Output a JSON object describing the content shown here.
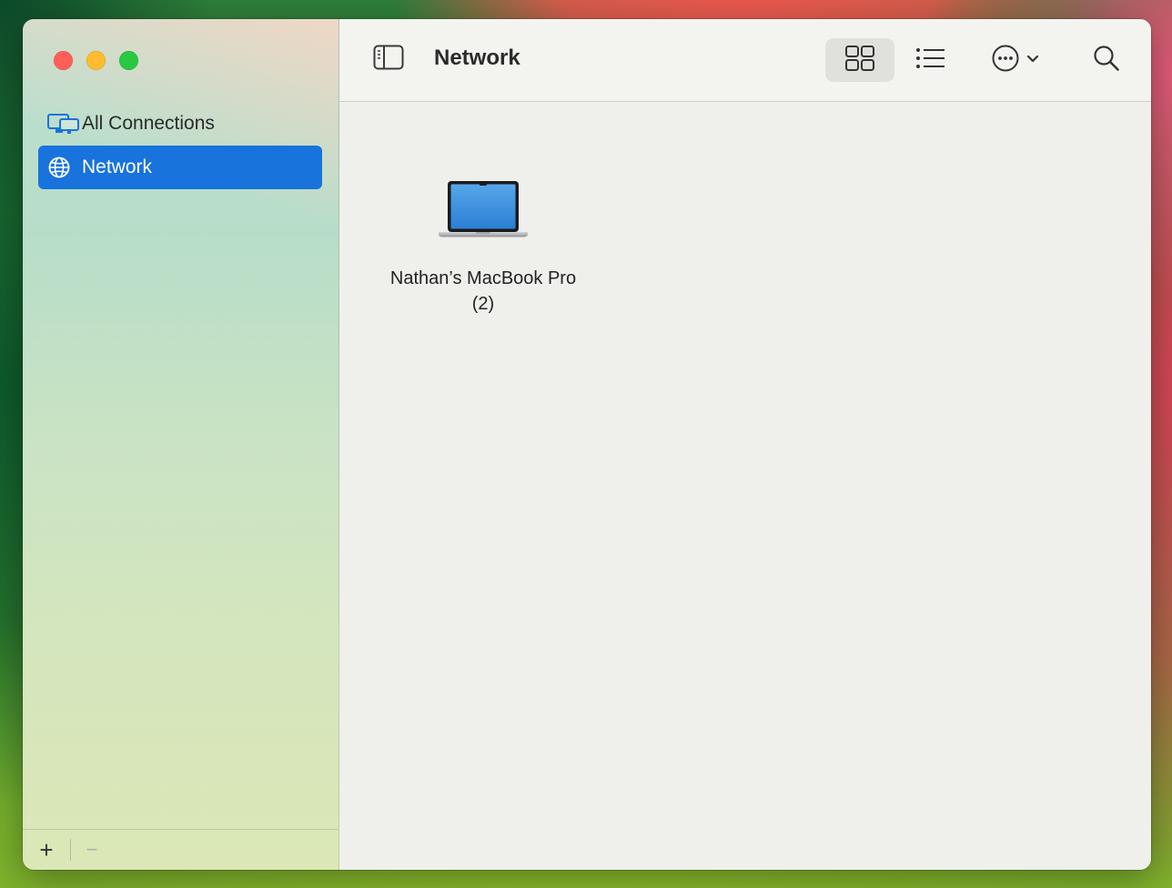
{
  "window": {
    "title": "Network"
  },
  "sidebar": {
    "items": [
      {
        "label": "All Connections",
        "icon": "displays-icon",
        "selected": false
      },
      {
        "label": "Network",
        "icon": "globe-icon",
        "selected": true
      }
    ],
    "add_label": "+",
    "remove_label": "−"
  },
  "toolbar": {
    "title": "Network",
    "view_mode": "icons"
  },
  "content": {
    "items": [
      {
        "label": "Nathan’s MacBook Pro (2)",
        "icon": "macbook-icon"
      }
    ]
  },
  "colors": {
    "accent": "#1873dd",
    "close": "#ff5f57",
    "minimize": "#febc2e",
    "maximize": "#28c840"
  }
}
